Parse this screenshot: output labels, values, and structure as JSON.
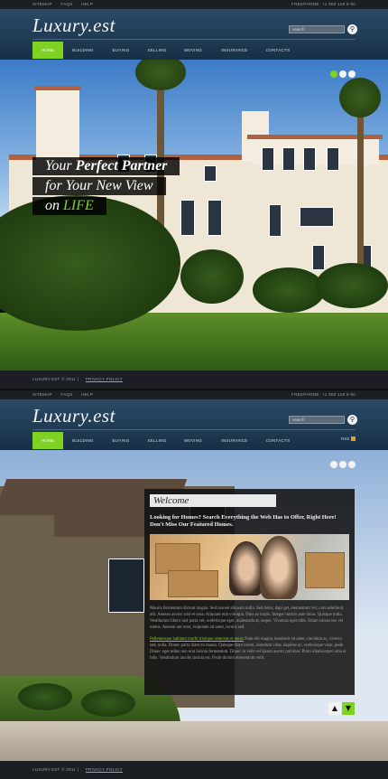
{
  "util": {
    "links": [
      "SITEMAP",
      "FAQS",
      "HELP"
    ],
    "phone": "FREEPHONE: +1 800 129 6 80"
  },
  "header": {
    "logo": "Luxury.est",
    "search_placeholder": "search",
    "rss": "RSS"
  },
  "nav": {
    "items": [
      "HOME",
      "BUILDING",
      "BUYING",
      "SELLING",
      "MOVING",
      "INSURANCE",
      "CONTACTS"
    ],
    "active": "HOME"
  },
  "slider": {
    "dots": 3,
    "active_dot": 1
  },
  "slogan": {
    "line1_pre": "Your ",
    "line1_bold": "Perfect Partner",
    "line2": "for Your New View",
    "line3_pre": "on ",
    "line3_green": "LIFE"
  },
  "welcome": {
    "title": "Welcome",
    "lead_bold": "Looking for Homes?",
    "lead_rest": " Search Everything the Web Has to Offer, Right Here! Don't Miss Our Featured Homes.",
    "para1": "Mauris fermentum dictum magna. Sed laoreet aliquam nulla. Sed dolor, dapi get, elementum vel, curs aeleifend, elit. Aenean auctor wisi et urna. Aliquam erat volutpat. Duis ac turpis. Integer rutrum ante lacus. Quisque nulla. Vestibulum libero nisl porta vel, scelerisque eget, malesuada at, neque. Vivamus eget nibh. Etiam cursus leo vel metus. Aenean nec eros, vulputate sit amet, iaculis sed.",
    "para2_link": "Pellentesque habitant morbi tristique senectus et netus",
    "para2": " Nam elit magna, hendrerit sit amet, tincidunt ac, viverra sed, nulla. Donec porta diam eu massa. Quisque diam lorem, interdum vitae, dapibus ac, scelerisque vitae, pede. Donec eget tellus non erat lacinia fermentum. Donec in velit vel ipsum auctor pulvinar. Proin ullamcorper urna et felis. Vestibulum iaculis lacinia est. Proin dictum elementum velit."
  },
  "footer": {
    "copyright": "LUXURY.EST © 2011",
    "privacy": "PRIVACY POLICY"
  },
  "colors": {
    "accent": "#7ed321",
    "header": "#1f3a55",
    "bar": "#1b1e22"
  }
}
